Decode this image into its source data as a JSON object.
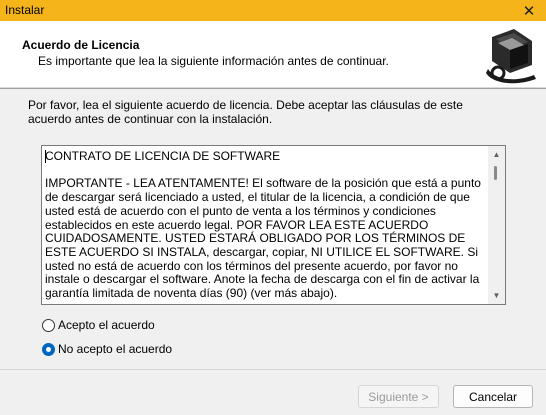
{
  "window": {
    "title": "Instalar",
    "close_glyph": "✕"
  },
  "header": {
    "title": "Acuerdo de Licencia",
    "subtitle": "Es importante que lea la siguiente información antes de continuar.",
    "logo_icon": "installer-computer-icon"
  },
  "main": {
    "intro_line1": "Por favor, lea el siguiente acuerdo de licencia. Debe aceptar las cláusulas de este",
    "intro_line2": "acuerdo antes de continuar con la instalación.",
    "license": {
      "title": "CONTRATO DE LICENCIA DE SOFTWARE",
      "body": "IMPORTANTE - LEA ATENTAMENTE! El software de la posición que está a punto de descargar será licenciado a usted, el titular de la licencia, a condición de que usted está de acuerdo con el punto de venta a los términos y condiciones establecidos en este acuerdo legal. POR FAVOR LEA ESTE ACUERDO CUIDADOSAMENTE. USTED ESTARÁ OBLIGADO POR LOS TÉRMINOS DE ESTE ACUERDO SI INSTALA, descargar, copiar, NI UTILICE EL SOFTWARE. Si usted no está de acuerdo con los términos del presente acuerdo, por favor no instale o descargar el software. Anote la fecha de descarga con el fin de activar la garantía limitada de noventa días (90) (ver más abajo)."
    },
    "radio_accept": {
      "label": "Acepto el acuerdo",
      "checked": false
    },
    "radio_decline": {
      "label": "No acepto el acuerdo",
      "checked": true
    }
  },
  "footer": {
    "next_label": "Siguiente >",
    "cancel_label": "Cancelar"
  },
  "colors": {
    "titlebar": "#f4b41a",
    "radio_selected": "#0067c0"
  }
}
